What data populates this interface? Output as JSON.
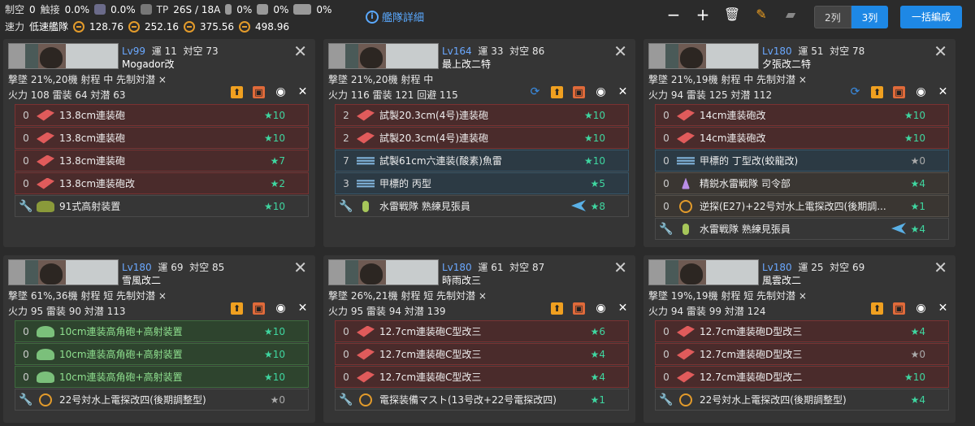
{
  "summary": {
    "row1": [
      {
        "label": "制空",
        "value": "0"
      },
      {
        "label": "触接",
        "value": "0.0%"
      },
      {
        "label": "",
        "value": "0.0%"
      },
      {
        "label": "TP",
        "value": "26S / 18A"
      },
      {
        "label": "",
        "value": "0%"
      },
      {
        "label": "",
        "value": "0%"
      },
      {
        "label": "",
        "value": "0%"
      }
    ],
    "speed_label": "速力",
    "speed_value": "低速艦隊",
    "row2_values": [
      "128.76",
      "252.16",
      "375.56",
      "498.96"
    ]
  },
  "fleet_details_label": "艦隊詳細",
  "column_toggle": {
    "two": "2列",
    "three": "3列"
  },
  "bulk_button": "一括編成",
  "ships": [
    {
      "level": "Lv99",
      "luck_label": "運",
      "luck": "11",
      "aa_label": "対空",
      "aa": "73",
      "name": "Mogador改",
      "line1": "撃墜 21%,20機  射程 中  先制対潜 ×",
      "line2": "火力 108  雷装 64  対潜 63",
      "has_refresh": false,
      "equips": [
        {
          "count": "0",
          "type": "gun",
          "name": "13.8cm連装砲",
          "star": "★10",
          "color": "red"
        },
        {
          "count": "0",
          "type": "gun",
          "name": "13.8cm連装砲",
          "star": "★10",
          "color": "red"
        },
        {
          "count": "0",
          "type": "gun",
          "name": "13.8cm連装砲",
          "star": "★7",
          "color": "red"
        },
        {
          "count": "0",
          "type": "gun",
          "name": "13.8cm連装砲改",
          "star": "★2",
          "color": "red"
        },
        {
          "count": "",
          "type": "aatank",
          "name": "91式高射装置",
          "star": "★10",
          "color": "ex"
        }
      ]
    },
    {
      "level": "Lv164",
      "luck_label": "運",
      "luck": "33",
      "aa_label": "対空",
      "aa": "86",
      "name": "最上改二特",
      "line1": "撃墜 21%,20機  射程 中",
      "line2": "火力 116  雷装 121  回避 115",
      "has_refresh": true,
      "equips": [
        {
          "count": "2",
          "type": "gun",
          "name": "試製20.3cm(4号)連装砲",
          "star": "★10",
          "color": "red"
        },
        {
          "count": "2",
          "type": "gun",
          "name": "試製20.3cm(4号)連装砲",
          "star": "★10",
          "color": "red"
        },
        {
          "count": "7",
          "type": "torp",
          "name": "試製61cm六連装(酸素)魚雷",
          "star": "★10",
          "color": "blue"
        },
        {
          "count": "3",
          "type": "torp",
          "name": "甲標的 丙型",
          "star": "★5",
          "color": "blue"
        },
        {
          "count": "",
          "type": "look",
          "name": "水雷戦隊 熟練見張員",
          "star": "★8",
          "color": "ex",
          "plane": true
        }
      ]
    },
    {
      "level": "Lv180",
      "luck_label": "運",
      "luck": "51",
      "aa_label": "対空",
      "aa": "78",
      "name": "夕張改二特",
      "line1": "撃墜 21%,19機  射程 中  先制対潜 ×",
      "line2": "火力 94  雷装 125  対潜 112",
      "has_refresh": true,
      "equips": [
        {
          "count": "0",
          "type": "gun",
          "name": "14cm連装砲改",
          "star": "★10",
          "color": "red"
        },
        {
          "count": "0",
          "type": "gun",
          "name": "14cm連装砲改",
          "star": "★10",
          "color": "red"
        },
        {
          "count": "0",
          "type": "torp",
          "name": "甲標的 丁型改(蛟龍改)",
          "star": "★0",
          "color": "blue",
          "zero": true
        },
        {
          "count": "0",
          "type": "crew",
          "name": "精鋭水雷戦隊 司令部",
          "star": "★4",
          "color": "dark"
        },
        {
          "count": "0",
          "type": "radar",
          "name": "逆探(E27)+22号対水上電探改四(後期調...",
          "star": "★1",
          "color": "dark"
        },
        {
          "count": "",
          "type": "look",
          "name": "水雷戦隊 熟練見張員",
          "star": "★4",
          "color": "ex",
          "plane": true
        }
      ]
    },
    {
      "level": "Lv180",
      "luck_label": "運",
      "luck": "69",
      "aa_label": "対空",
      "aa": "85",
      "name": "雪風改二",
      "line1": "撃墜 61%,36機  射程 短  先制対潜 ×",
      "line2": "火力 95  雷装 90  対潜 113",
      "has_refresh": false,
      "equips": [
        {
          "count": "0",
          "type": "aa",
          "name": "10cm連装高角砲+高射装置",
          "star": "★10",
          "color": "green"
        },
        {
          "count": "0",
          "type": "aa",
          "name": "10cm連装高角砲+高射装置",
          "star": "★10",
          "color": "green"
        },
        {
          "count": "0",
          "type": "aa",
          "name": "10cm連装高角砲+高射装置",
          "star": "★10",
          "color": "green"
        },
        {
          "count": "",
          "type": "radar",
          "name": "22号対水上電探改四(後期調整型)",
          "star": "★0",
          "color": "ex",
          "zero": true
        }
      ]
    },
    {
      "level": "Lv180",
      "luck_label": "運",
      "luck": "61",
      "aa_label": "対空",
      "aa": "87",
      "name": "時雨改三",
      "line1": "撃墜 26%,21機  射程 短  先制対潜 ×",
      "line2": "火力 95  雷装 94  対潜 139",
      "has_refresh": false,
      "equips": [
        {
          "count": "0",
          "type": "gun",
          "name": "12.7cm連装砲C型改三",
          "star": "★6",
          "color": "red"
        },
        {
          "count": "0",
          "type": "gun",
          "name": "12.7cm連装砲C型改三",
          "star": "★4",
          "color": "red"
        },
        {
          "count": "0",
          "type": "gun",
          "name": "12.7cm連装砲C型改三",
          "star": "★4",
          "color": "red"
        },
        {
          "count": "",
          "type": "radar",
          "name": "電探装備マスト(13号改+22号電探改四)",
          "star": "★1",
          "color": "ex"
        }
      ]
    },
    {
      "level": "Lv180",
      "luck_label": "運",
      "luck": "25",
      "aa_label": "対空",
      "aa": "69",
      "name": "風雲改二",
      "line1": "撃墜 19%,19機  射程 短  先制対潜 ×",
      "line2": "火力 94  雷装 99  対潜 124",
      "has_refresh": false,
      "equips": [
        {
          "count": "0",
          "type": "gun",
          "name": "12.7cm連装砲D型改三",
          "star": "★4",
          "color": "red"
        },
        {
          "count": "0",
          "type": "gun",
          "name": "12.7cm連装砲D型改三",
          "star": "★0",
          "color": "red",
          "zero": true
        },
        {
          "count": "0",
          "type": "gun",
          "name": "12.7cm連装砲D型改二",
          "star": "★10",
          "color": "red"
        },
        {
          "count": "",
          "type": "radar",
          "name": "22号対水上電探改四(後期調整型)",
          "star": "★4",
          "color": "ex"
        }
      ]
    }
  ]
}
